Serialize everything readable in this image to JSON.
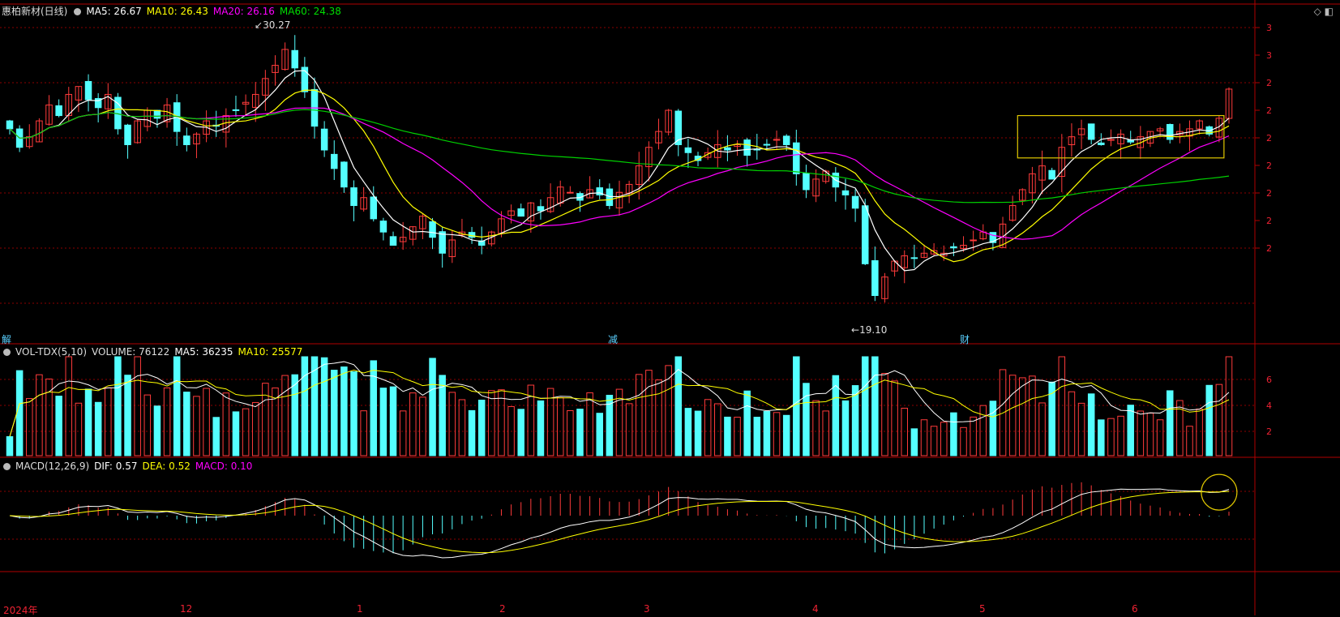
{
  "stock": {
    "title": "惠柏新材(日线)",
    "ma5_label": "MA5: 26.67",
    "ma10_label": "MA10: 26.43",
    "ma20_label": "MA20: 26.16",
    "ma60_label": "MA60: 24.38"
  },
  "volume_panel": {
    "name": "VOL-TDX(5,10)",
    "volume_label": "VOLUME: 76122",
    "ma5_label": "MA5: 36235",
    "ma10_label": "MA10: 25577"
  },
  "macd_panel": {
    "name": "MACD(12,26,9)",
    "dif_label": "DIF: 0.57",
    "dea_label": "DEA: 0.52",
    "macd_label": "MACD: 0.10"
  },
  "annotations": {
    "high_label": "30.27",
    "low_label": "19.10"
  },
  "event_markers": [
    "解",
    "减",
    "财"
  ],
  "x_axis_labels": [
    "2024年",
    "12",
    "1",
    "2",
    "3",
    "4",
    "5",
    "6"
  ],
  "right_axis": {
    "price_ticks": [
      "3",
      "3",
      "2",
      "2",
      "2",
      "2",
      "2",
      "2",
      "2"
    ],
    "volume_ticks": [
      "6",
      "4",
      "2"
    ]
  },
  "colors": {
    "up": "#ff3b3b",
    "down": "#54ffff",
    "ma5": "#ffffff",
    "ma10": "#ffff00",
    "ma20": "#ff00ff",
    "ma60": "#00d000",
    "grid": "#8b0000",
    "box": "#e0c800"
  },
  "icons": {
    "diamond": "diamond-icon",
    "window": "window-icon",
    "collapse": "collapse-icon"
  },
  "chart_data": {
    "type": "candlestick",
    "price_range": [
      18.5,
      31.0
    ],
    "highest": 30.27,
    "lowest": 19.1,
    "latest": {
      "ma5": 26.67,
      "ma10": 26.43,
      "ma20": 26.16,
      "ma60": 24.38,
      "volume": 76122,
      "vol_ma5": 36235,
      "vol_ma10": 25577,
      "dif": 0.57,
      "dea": 0.52,
      "macd": 0.1
    },
    "closes": [
      26.5,
      25.8,
      26.2,
      26.8,
      27.4,
      27.0,
      27.8,
      28.1,
      27.6,
      27.3,
      27.8,
      26.5,
      25.9,
      26.8,
      27.2,
      26.9,
      27.4,
      26.4,
      25.9,
      26.3,
      26.8,
      26.6,
      27.0,
      27.2,
      27.5,
      27.8,
      28.4,
      28.9,
      29.5,
      28.8,
      27.9,
      26.6,
      25.7,
      25.0,
      24.3,
      23.6,
      23.9,
      23.1,
      22.6,
      22.1,
      22.4,
      22.8,
      23.2,
      22.4,
      21.8,
      22.3,
      22.6,
      22.4,
      22.1,
      22.6,
      23.1,
      23.4,
      23.2,
      23.7,
      23.4,
      23.9,
      24.3,
      24.1,
      23.8,
      24.2,
      24.0,
      23.6,
      24.1,
      24.4,
      25.1,
      25.8,
      26.4,
      27.2,
      25.9,
      25.6,
      25.3,
      25.6,
      25.9,
      25.7,
      25.9,
      25.5,
      25.7,
      25.9,
      26.1,
      25.9,
      24.8,
      24.2,
      24.6,
      24.9,
      24.3,
      24.0,
      23.5,
      21.4,
      20.2,
      20.9,
      21.5,
      21.7,
      21.6,
      21.8,
      21.9,
      21.8,
      22.0,
      22.1,
      22.3,
      22.6,
      22.2,
      22.9,
      23.6,
      24.2,
      24.8,
      25.1,
      24.6,
      25.8,
      26.2,
      26.5,
      26.1,
      25.9,
      26.1,
      26.3,
      26.0,
      26.2,
      26.4,
      26.5,
      26.1,
      26.4,
      26.5,
      26.8,
      26.3,
      26.9,
      28.0
    ]
  }
}
